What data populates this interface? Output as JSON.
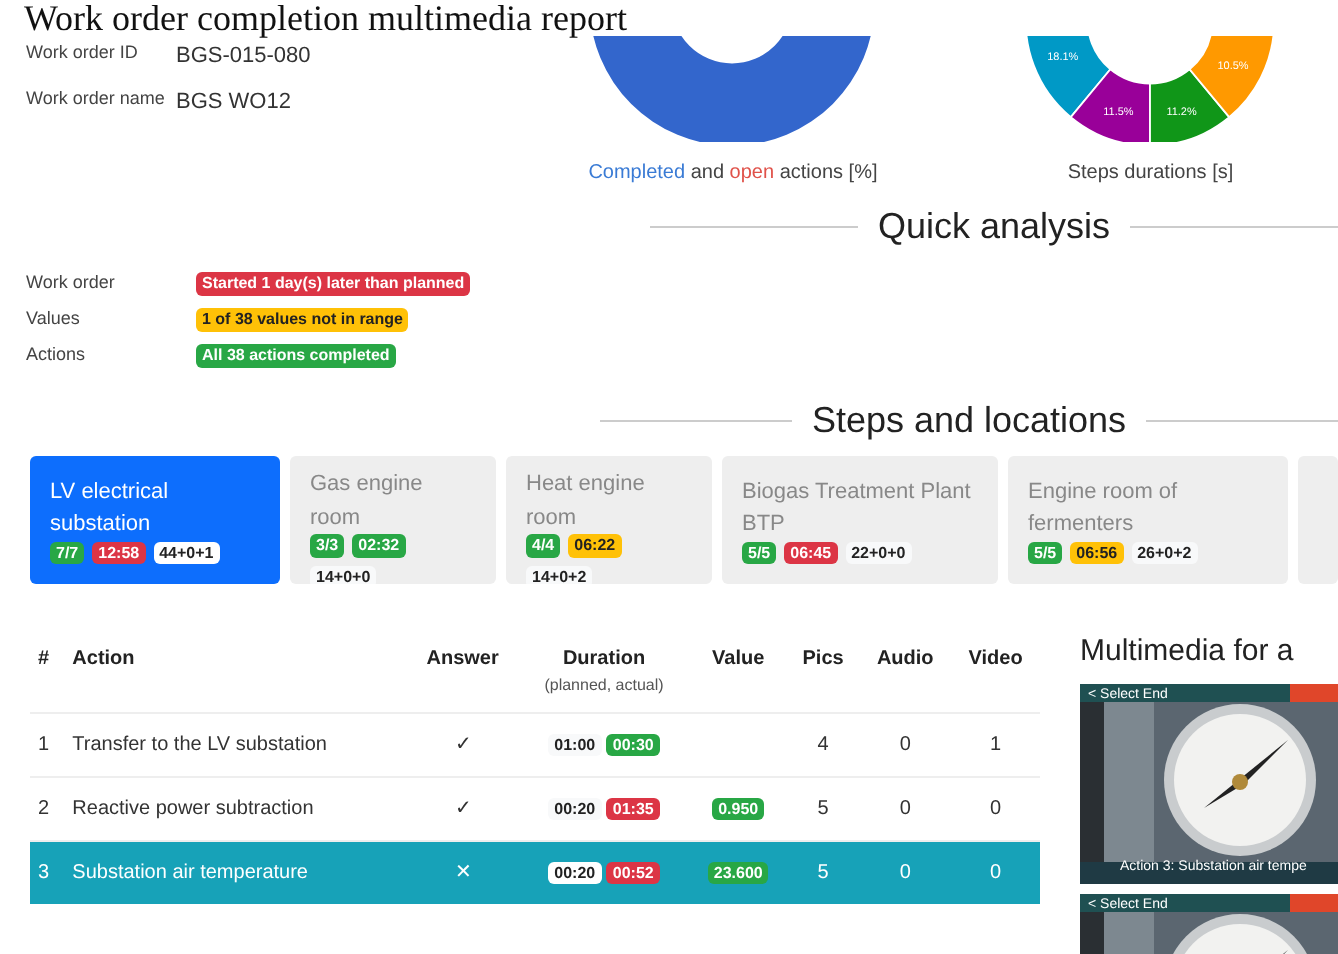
{
  "title": "Work order completion multimedia report",
  "info": [
    {
      "label": "Work order ID",
      "value": "BGS-015-080"
    },
    {
      "label": "Work order name",
      "value": "BGS WO12"
    }
  ],
  "actions_chart": {
    "caption": [
      {
        "text": "Completed",
        "kind": "completed"
      },
      {
        "text": " and ",
        "kind": "plain"
      },
      {
        "text": "open",
        "kind": "open"
      },
      {
        "text": " actions [%]",
        "kind": "plain"
      }
    ]
  },
  "steps_chart": {
    "slice_labels": [
      "18.1%",
      "11.5%",
      "11.2%",
      "10.5%"
    ],
    "caption": "Steps durations [s]"
  },
  "quick_analysis": {
    "heading": "Quick analysis",
    "rows": [
      {
        "label": "Work order",
        "badge": "Started 1 day(s) later than planned",
        "color": "#dc3545"
      },
      {
        "label": "Values",
        "badge": "1 of 38 values not in range",
        "color": "#ffc107"
      },
      {
        "label": "Actions",
        "badge": "All 38 actions completed",
        "color": "#28a745"
      }
    ]
  },
  "steps": {
    "heading": "Steps and locations",
    "items": [
      {
        "name": "LV electrical substation",
        "selected": true,
        "count": "7/7",
        "time": {
          "text": "12:58",
          "color": "#dc3545"
        },
        "totals": "44+0+1"
      },
      {
        "name": "Gas engine room",
        "selected": false,
        "count": "3/3",
        "time": {
          "text": "02:32",
          "color": "#28a745"
        },
        "totals": "14+0+0"
      },
      {
        "name": "Heat engine room",
        "selected": false,
        "count": "4/4",
        "time": {
          "text": "06:22",
          "color": "#ffc107"
        },
        "totals": "14+0+2"
      },
      {
        "name": "Biogas Treatment Plant BTP",
        "selected": false,
        "count": "5/5",
        "time": {
          "text": "06:45",
          "color": "#dc3545"
        },
        "totals": "22+0+0"
      },
      {
        "name": "Engine room of fermenters",
        "selected": false,
        "count": "5/5",
        "time": {
          "text": "06:56",
          "color": "#ffc107"
        },
        "totals": "26+0+2"
      }
    ]
  },
  "table": {
    "columns": [
      {
        "label": "#"
      },
      {
        "label": "Action"
      },
      {
        "label": "Answer"
      },
      {
        "label": "Duration",
        "sub": "(planned, actual)"
      },
      {
        "label": "Value"
      },
      {
        "label": "Pics"
      },
      {
        "label": "Audio"
      },
      {
        "label": "Video"
      }
    ],
    "rows": [
      {
        "num": "1",
        "action": "Transfer to the LV substation",
        "answer": "✓",
        "planned": "01:00",
        "actual": {
          "text": "00:30",
          "color": "#28a745"
        },
        "pics": "4",
        "audio": "0",
        "video": "1",
        "selected": false
      },
      {
        "num": "2",
        "action": "Reactive power subtraction",
        "answer": "✓",
        "planned": "00:20",
        "actual": {
          "text": "01:35",
          "color": "#dc3545"
        },
        "value": {
          "text": "0.950",
          "color": "#28a745"
        },
        "pics": "5",
        "audio": "0",
        "video": "0",
        "selected": false
      },
      {
        "num": "3",
        "action": "Substation air temperature",
        "answer": "✕",
        "planned": "00:20",
        "actual": {
          "text": "00:52",
          "color": "#dc3545"
        },
        "value": {
          "text": "23.600",
          "color": "#28a745"
        },
        "pics": "5",
        "audio": "0",
        "video": "0",
        "selected": true
      }
    ]
  },
  "multimedia": {
    "heading": "Multimedia for a",
    "frames": [
      {
        "kind": "picture",
        "top_label": "< Select End",
        "caption": "Action 3: Substation air tempe"
      },
      {
        "kind": "picture",
        "top_label": "< Select End"
      }
    ]
  }
}
